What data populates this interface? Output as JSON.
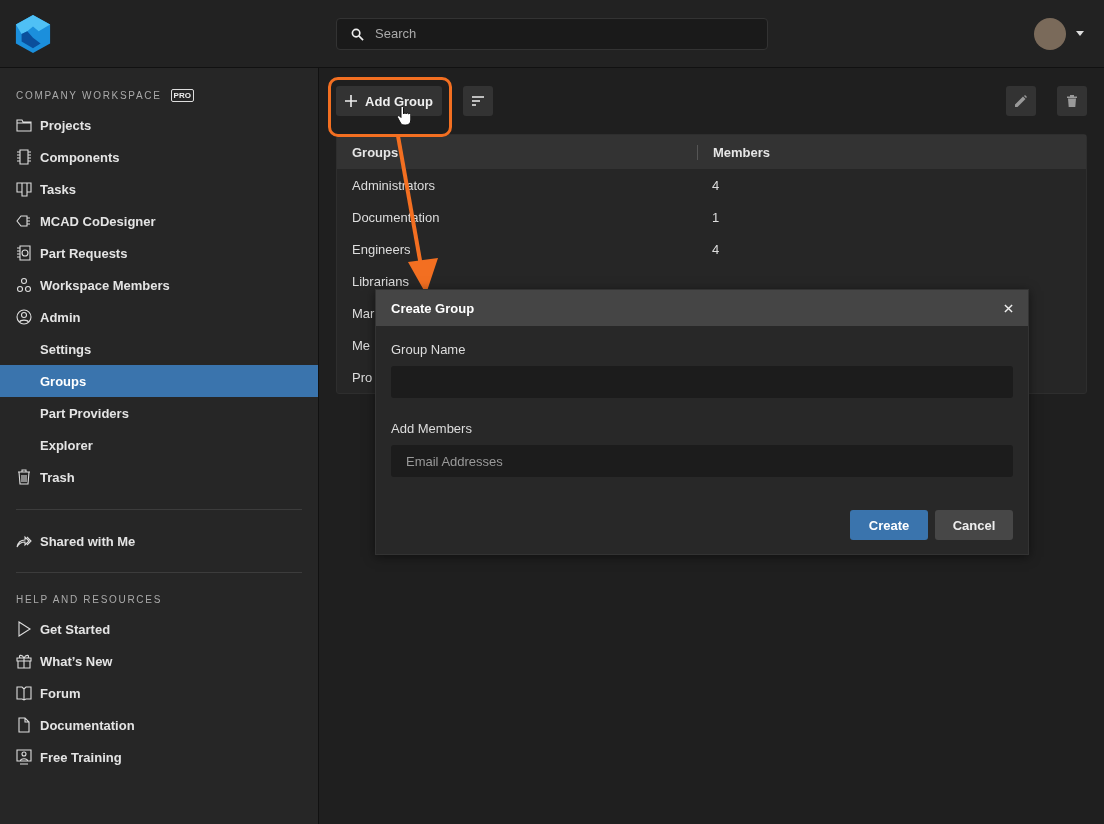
{
  "search": {
    "placeholder": "Search"
  },
  "sidebar": {
    "workspace_heading": "COMPANY WORKSPACE",
    "plan_badge": "PRO",
    "items": [
      {
        "label": "Projects",
        "selected": false
      },
      {
        "label": "Components",
        "selected": false
      },
      {
        "label": "Tasks",
        "selected": false
      },
      {
        "label": "MCAD CoDesigner",
        "selected": false
      },
      {
        "label": "Part Requests",
        "selected": false
      },
      {
        "label": "Workspace Members",
        "selected": false
      },
      {
        "label": "Admin",
        "selected": false,
        "children": [
          {
            "label": "Settings",
            "selected": false
          },
          {
            "label": "Groups",
            "selected": true
          },
          {
            "label": "Part Providers",
            "selected": false
          },
          {
            "label": "Explorer",
            "selected": false
          }
        ]
      },
      {
        "label": "Trash",
        "selected": false
      }
    ],
    "shared": {
      "label": "Shared with Me",
      "selected": false
    },
    "help_heading": "HELP AND RESOURCES",
    "help_items": [
      {
        "label": "Get Started"
      },
      {
        "label": "What’s New"
      },
      {
        "label": "Forum"
      },
      {
        "label": "Documentation"
      },
      {
        "label": "Free Training"
      }
    ]
  },
  "toolbar": {
    "add_button": "Add Group"
  },
  "table": {
    "columns": [
      "Groups",
      "Members"
    ],
    "rows": [
      [
        "Administrators",
        "4"
      ],
      [
        "Documentation",
        "1"
      ],
      [
        "Engineers",
        "4"
      ],
      [
        "Librarians",
        ""
      ],
      [
        "Mar",
        ""
      ],
      [
        "Me",
        ""
      ],
      [
        "Pro",
        ""
      ]
    ]
  },
  "dialog": {
    "title": "Create Group",
    "fields": [
      {
        "label": "Group Name"
      },
      {
        "label": "Add Members",
        "placeholder": "Email Addresses"
      }
    ],
    "buttons": [
      {
        "label": "Create",
        "kind": "primary"
      },
      {
        "label": "Cancel",
        "kind": "secondary"
      }
    ]
  }
}
